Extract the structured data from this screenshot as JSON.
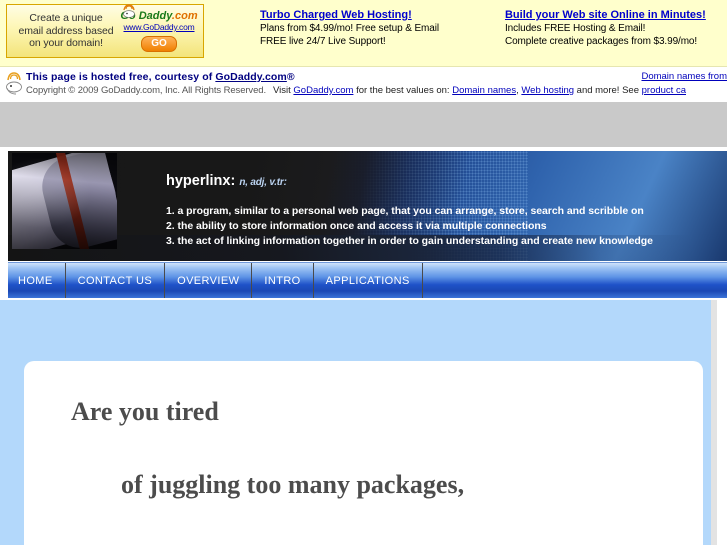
{
  "ad_strip": {
    "promo_box": {
      "line1": "Create a unique",
      "line2": "email address based",
      "line3": "on your domain!",
      "logo": "Go Daddy",
      "logo_suffix": ".com",
      "url": "www.GoDaddy.com",
      "button": "GO",
      "icon": "godaddy-guy-icon"
    },
    "columns": [
      {
        "heading": "Turbo Charged Web Hosting!",
        "lines": [
          "Plans from $4.99/mo! Free setup & Email",
          "FREE live 24/7 Live Support!"
        ]
      },
      {
        "heading": "Build your Web site Online in Minutes!",
        "lines": [
          "Includes FREE Hosting & Email!",
          "Complete creative packages from $3.99/mo!"
        ]
      }
    ]
  },
  "host_bar": {
    "icon": "godaddy-guy-icon",
    "title_prefix": "This page is hosted free, courtesy of ",
    "title_link": "GoDaddy.com",
    "title_suffix": "®",
    "copyright": "Copyright © 2009 GoDaddy.com, Inc. All Rights Reserved.",
    "right_top": "Domain names from",
    "right_bottom_1": "Visit ",
    "right_bottom_link1": "GoDaddy.com",
    "right_bottom_2": " for the best values on: ",
    "right_bottom_link2": "Domain names",
    "right_bottom_3": ", ",
    "right_bottom_link3": "Web hosting",
    "right_bottom_4": " and more! See ",
    "right_bottom_link4": "product ca"
  },
  "banner": {
    "title": "hyperlinx:",
    "part_of_speech": "n, adj, v.tr:",
    "definitions": [
      "1. a program, similar to a personal web page, that you can arrange, store, search and scribble on",
      "2. the ability to store information once and access it via multiple connections",
      "3. the act of linking information together in order to gain understanding and create new knowledge"
    ],
    "book_image_alt": "open-book-image"
  },
  "nav": {
    "items": [
      {
        "label": "HOME"
      },
      {
        "label": "CONTACT US"
      },
      {
        "label": "OVERVIEW"
      },
      {
        "label": "INTRO"
      },
      {
        "label": "APPLICATIONS"
      }
    ]
  },
  "main": {
    "headline_1": "Are you tired",
    "headline_2": "of juggling too many packages,"
  },
  "colors": {
    "ad_background": "#ffffcc",
    "page_blue": "#b3d8fb",
    "nav_blue": "#1f52c8",
    "banner_dark": "#1b1b1b",
    "headline_gray": "#4c4c4c",
    "link_blue": "#0000cc"
  }
}
